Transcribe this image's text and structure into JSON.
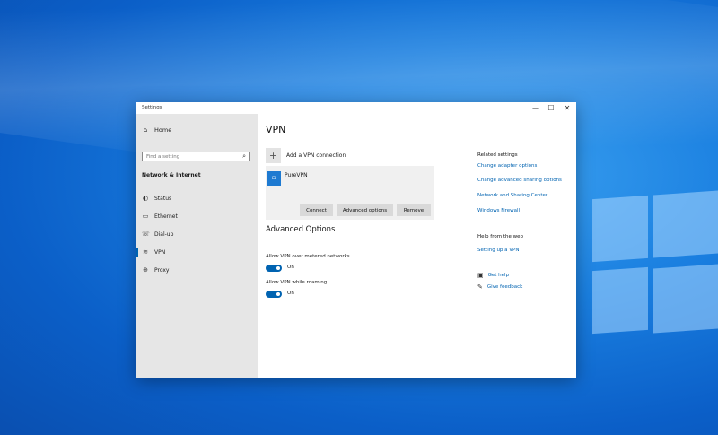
{
  "window": {
    "title": "Settings",
    "controls": {
      "minimize": "—",
      "maximize": "☐",
      "close": "✕"
    }
  },
  "sidebar": {
    "home": {
      "icon": "home-icon",
      "label": "Home"
    },
    "search_placeholder": "Find a setting",
    "section": "Network & Internet",
    "items": [
      {
        "icon": "globe-status-icon",
        "label": "Status"
      },
      {
        "icon": "ethernet-icon",
        "label": "Ethernet"
      },
      {
        "icon": "phone-dialup-icon",
        "label": "Dial-up"
      },
      {
        "icon": "vpn-icon",
        "label": "VPN",
        "active": true
      },
      {
        "icon": "proxy-globe-icon",
        "label": "Proxy"
      }
    ]
  },
  "main": {
    "title": "VPN",
    "add_connection": "Add a VPN connection",
    "connection": {
      "name": "PureVPN",
      "buttons": {
        "connect": "Connect",
        "advanced": "Advanced options",
        "remove": "Remove"
      }
    },
    "advanced": {
      "title": "Advanced Options",
      "options": [
        {
          "label": "Allow VPN over metered networks",
          "state": "On"
        },
        {
          "label": "Allow VPN while roaming",
          "state": "On"
        }
      ]
    }
  },
  "related": {
    "heading": "Related settings",
    "links": [
      "Change adapter options",
      "Change advanced sharing options",
      "Network and Sharing Center",
      "Windows Firewall"
    ],
    "help_heading": "Help from the web",
    "help_link": "Setting up a VPN",
    "get_help": "Get help",
    "feedback": "Give feedback"
  },
  "colors": {
    "accent": "#0063b1",
    "sidebar_bg": "#e6e6e6",
    "desktop": "#1a7fe0"
  }
}
